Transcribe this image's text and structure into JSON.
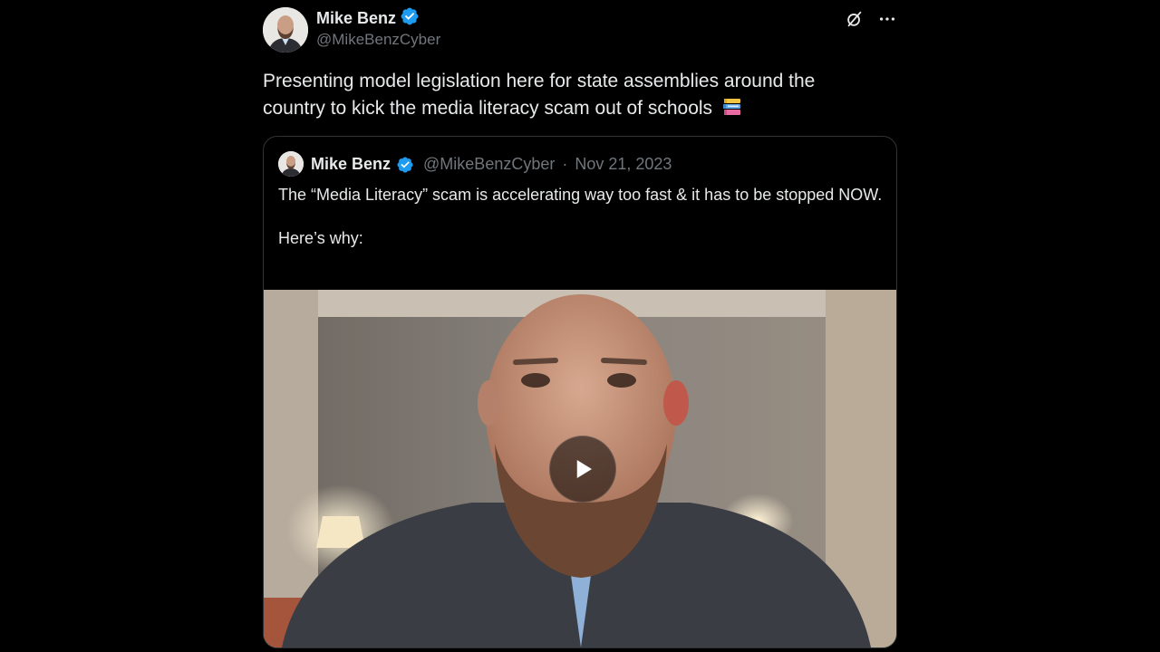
{
  "tweet": {
    "author_name": "Mike Benz",
    "author_handle": "@MikeBenzCyber",
    "verified": true,
    "text": "Presenting model legislation here for state assemblies around the country to kick the media literacy scam out of schools",
    "emoji": "books-emoji"
  },
  "actions": {
    "grok_icon": "grok-icon",
    "more_icon": "more-icon",
    "more_label": "···"
  },
  "quote": {
    "author_name": "Mike Benz",
    "author_handle": "@MikeBenzCyber",
    "separator": "·",
    "date": "Nov 21, 2023",
    "text": "The “Media Literacy” scam is accelerating way too fast & it has to be stopped NOW.\n\nHere’s why:",
    "media_type": "video",
    "play_icon": "play-icon"
  },
  "colors": {
    "background": "#000000",
    "text_primary": "#e7e9ea",
    "text_secondary": "#71767b",
    "verified_blue": "#1d9bf0",
    "border": "#2f3336"
  }
}
